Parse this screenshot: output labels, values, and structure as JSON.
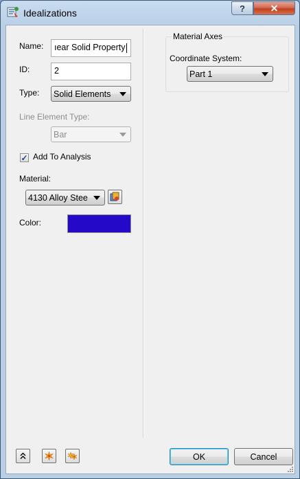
{
  "window": {
    "title": "Idealizations"
  },
  "titlebar": {
    "help_glyph": "?",
    "close_glyph": "✕"
  },
  "form": {
    "name_label": "Name:",
    "name_value": "ıear Solid Property",
    "id_label": "ID:",
    "id_value": "2",
    "type_label": "Type:",
    "type_value": "Solid Elements",
    "line_element_type_label": "Line Element Type:",
    "line_element_type_value": "Bar",
    "add_to_analysis_label": "Add To Analysis",
    "add_to_analysis_checked": true,
    "material_label": "Material:",
    "material_value": "4130 Alloy Stee",
    "color_label": "Color:",
    "color_value": "#2409c8"
  },
  "material_axes": {
    "group_title": "Material Axes",
    "coordinate_system_label": "Coordinate System:",
    "coordinate_system_value": "Part 1"
  },
  "footer": {
    "ok_label": "OK",
    "cancel_label": "Cancel"
  },
  "icons": [
    "idealizations-app-icon",
    "material-library-icon",
    "collapse-icon",
    "new-idealization-icon",
    "new-multiple-icon"
  ]
}
